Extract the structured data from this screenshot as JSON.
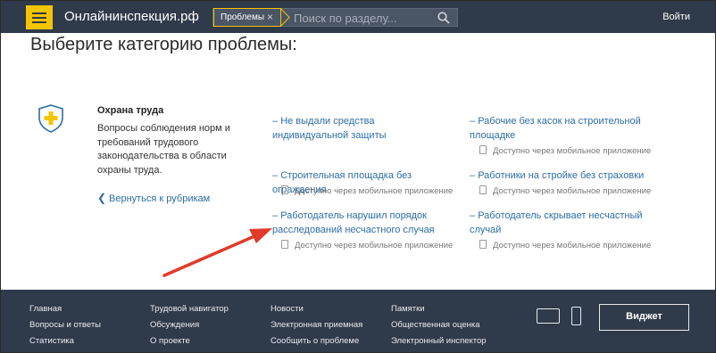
{
  "header": {
    "site_title": "Онлайнинспекция.рф",
    "search_tag": "Проблемы",
    "search_placeholder": "Поиск по разделу...",
    "login_label": "Войти"
  },
  "page_title": "Выберите категорию проблемы:",
  "category": {
    "title": "Охрана труда",
    "description": "Вопросы соблюдения норм и требований трудового законодательства в области охраны труда.",
    "back_label": "Вернуться к рубрикам"
  },
  "problems": [
    {
      "text": "Не выдали средства индивидуальной защиты",
      "note": ""
    },
    {
      "text": "Рабочие без касок на строительной площадке",
      "note": "Доступно через мобильное приложение"
    },
    {
      "text": "Строительная площадка без ограждения",
      "note": "Доступно через мобильное приложение"
    },
    {
      "text": "Работники на стройке без страховки",
      "note": "Доступно через мобильное приложение"
    },
    {
      "text": "Работодатель нарушил порядок расследований несчастного случая",
      "note": "Доступно через мобильное приложение"
    },
    {
      "text": "Работодатель скрывает несчастный случай",
      "note": "Доступно через мобильное приложение"
    }
  ],
  "footer": {
    "col1": [
      "Главная",
      "Вопросы и ответы",
      "Статистика"
    ],
    "col2": [
      "Трудовой навигатор",
      "Обсуждения",
      "О проекте"
    ],
    "col3": [
      "Новости",
      "Электронная приемная",
      "Сообщить о проблеме"
    ],
    "col4": [
      "Памятки",
      "Общественная оценка",
      "Электронный инспектор"
    ],
    "widget_label": "Виджет"
  },
  "colors": {
    "header_bg": "#2f3a4a",
    "accent_yellow": "#f5c400",
    "link_blue": "#2e6da4",
    "annotation_arrow": "#e03a2b"
  }
}
